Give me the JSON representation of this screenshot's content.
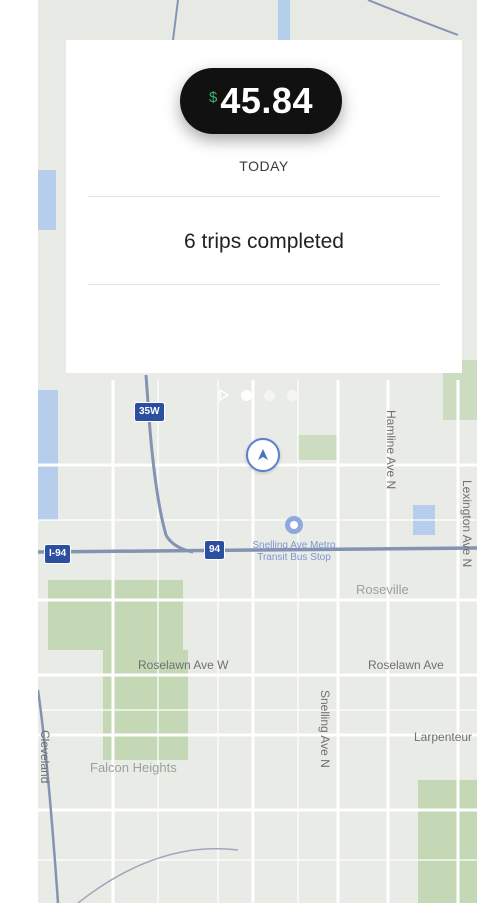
{
  "earnings": {
    "currency_symbol": "$",
    "amount": "45.84",
    "period": "TODAY"
  },
  "summary": {
    "trips_text": "6 trips completed"
  },
  "pager": {
    "total_pages": 3,
    "active_page": 1
  },
  "map": {
    "highways": [
      {
        "id": "i35w",
        "label": "35W"
      },
      {
        "id": "i94-left",
        "label": "I-94"
      },
      {
        "id": "i94",
        "label": "94"
      }
    ],
    "transit_stop": "Snelling Ave Metro Transit Bus Stop",
    "streets": {
      "hamline": "Hamline Ave N",
      "lexington": "Lexington Ave N",
      "snelling": "Snelling Ave N",
      "larpenteur_w": "Roselawn Ave W",
      "roselawn_e": "Roselawn Ave",
      "larpenteur_e": "Larpenteur",
      "left_road": "Cleveland"
    },
    "areas": {
      "falcon_heights": "Falcon Heights",
      "roseville": "Roseville"
    },
    "colors": {
      "water": "#a9c7ee",
      "park": "#b7d2a6",
      "highway": "#8593b3",
      "road": "#ffffff"
    }
  }
}
